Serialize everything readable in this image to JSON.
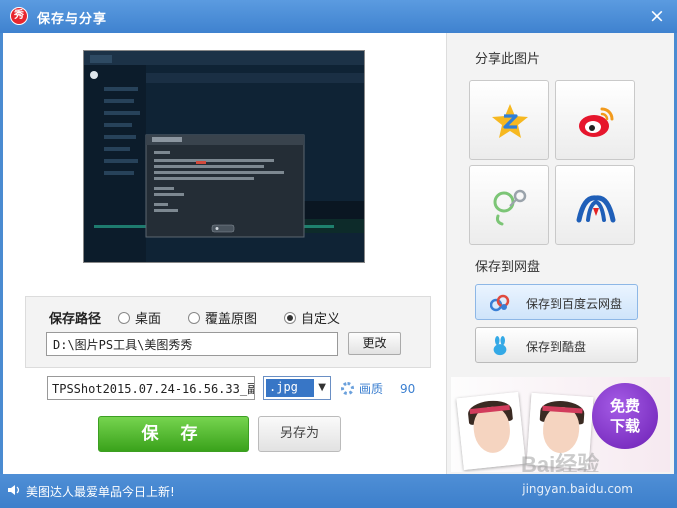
{
  "window": {
    "title": "保存与分享",
    "logo_text": "秀",
    "close_icon": "×"
  },
  "preview": {
    "alt": "截图预览"
  },
  "save_path": {
    "label": "保存路径",
    "options": [
      "桌面",
      "覆盖原图",
      "自定义"
    ],
    "selected": "自定义",
    "path_value": "D:\\图片PS工具\\美图秀秀",
    "change_label": "更改"
  },
  "file": {
    "name_value": "TPSShot2015.07.24-16.56.33_副",
    "extension": ".jpg",
    "quality_label": "画质",
    "quality_value": "90"
  },
  "actions": {
    "save_label": "保 存",
    "save_as_label": "另存为"
  },
  "share": {
    "heading": "分享此图片",
    "services": [
      "qq-zone-icon",
      "weibo-icon",
      "pengyou-icon",
      "renren-icon"
    ]
  },
  "cloud": {
    "heading": "保存到网盘",
    "baidu_label": "保存到百度云网盘",
    "kupan_label": "保存到酷盘"
  },
  "ad": {
    "line1": "免费",
    "line2": "下载",
    "watermark": "Bai经验"
  },
  "status": {
    "message": "美图达人最爱单品今日上新!",
    "site": "jingyan.baidu.com"
  },
  "colors": {
    "titlebar": "#4a8bd1",
    "save_green": "#3aa21b",
    "accent_blue": "#3b7fd0"
  }
}
